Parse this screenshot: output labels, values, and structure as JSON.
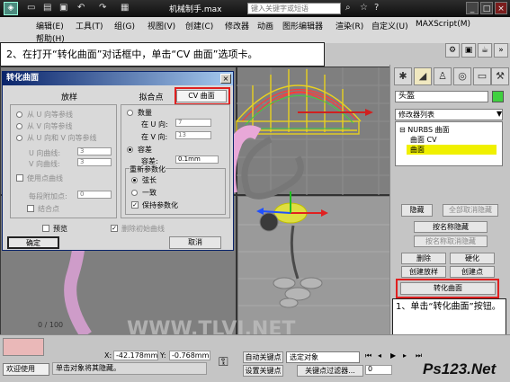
{
  "window": {
    "app_name": "机械制手.max",
    "search_placeholder": "键入关键字或短语"
  },
  "menu": [
    "编辑(E)",
    "工具(T)",
    "组(G)",
    "视图(V)",
    "创建(C)",
    "修改器",
    "动画",
    "图形编辑器",
    "渲染(R)",
    "自定义(U)",
    "MAXScript(M)",
    "帮助(H)"
  ],
  "instruction": "2、在打开“转化曲面”对话框中，单击“CV 曲面”选项卡。",
  "dialog": {
    "title": "转化曲面",
    "tabs": [
      "放样",
      "拟合点",
      "CV 曲面"
    ],
    "loft": {
      "options": [
        "从 U 向等参线",
        "从 V 向等参线",
        "从 U 向和 V 向等参线"
      ],
      "u_curves_label": "U 向曲线:",
      "u_curves_value": "3",
      "v_curves_label": "V 向曲线:",
      "v_curves_value": "3",
      "use_point_curves": "使用点曲线",
      "extra_points_label": "每段附加点:",
      "extra_points_value": "0",
      "fit_points": "结合点"
    },
    "fit": {
      "count_label": "数量",
      "u_label": "在 U 向:",
      "u_value": "7",
      "v_label": "在 V 向:",
      "v_value": "13",
      "tol_label": "容差",
      "tol_field_label": "容差:",
      "tol_value": "0.1mm"
    },
    "reparam": {
      "title": "重新参数化",
      "options": [
        "弦长",
        "一致"
      ],
      "keep": "保持参数化"
    },
    "preview": "预览",
    "delete_original": "删除初始曲线",
    "ok": "确定",
    "cancel": "取消"
  },
  "right_panel": {
    "object_name": "头盔",
    "modifier_list": "修改器列表",
    "tree": [
      "NURBS 曲面",
      "曲面 CV",
      "曲面"
    ],
    "buttons": {
      "hide": "隐藏",
      "unhide_all": "全部取消隐藏",
      "hide_by_name": "按名称隐藏",
      "unhide_by_name": "按名称取消隐藏",
      "delete": "删除",
      "harden": "硬化",
      "create_loft": "创建放样",
      "create_point": "创建点",
      "convert_surface": "转化曲面"
    }
  },
  "callout": "1、单击“转化曲面”按钮。",
  "statusbar": {
    "frame_counter": "0 / 100",
    "welcome": "欢迎使用",
    "prompt": "单击对象将其隐藏。",
    "x_label": "X:",
    "x_value": "-42.178mm",
    "y_label": "Y:",
    "y_value": "-0.768mm",
    "auto_key": "自动关键点",
    "selected_object": "选定对象",
    "set_key": "设置关键点",
    "key_filters": "关键点过滤器...",
    "frame_value": "0"
  },
  "watermark": "Ps123.Net",
  "watermark_site": "WWW.TLVI.NET"
}
